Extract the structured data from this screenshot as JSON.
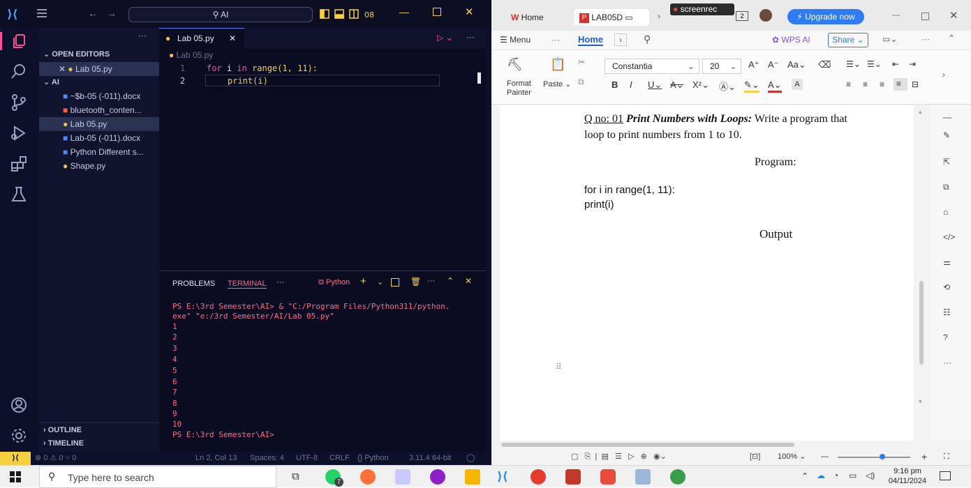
{
  "vscode": {
    "search": "AI",
    "explorer": {
      "open_editors_label": "OPEN EDITORS",
      "open_file": "Lab 05.py",
      "folder_label": "AI",
      "files": [
        "~$b-05 (-011).docx",
        "bluetooth_conten...",
        "Lab 05.py",
        "Lab-05 (-011).docx",
        "Python Different s...",
        "Shape.py"
      ],
      "outline_label": "OUTLINE",
      "timeline_label": "TIMELINE"
    },
    "tab_label": "Lab 05.py",
    "breadcrumb": "Lab 05.py",
    "code_lines": [
      {
        "num": "1",
        "kw1": "for",
        "var": "i",
        "kw2": "in",
        "fn": "range",
        "args": "(1, 11):"
      },
      {
        "num": "2",
        "fn": "print",
        "args": "(i)"
      }
    ],
    "panel": {
      "problems_label": "PROBLEMS",
      "terminal_label": "TERMINAL",
      "more_label": "···",
      "python_label": "Python",
      "lines": [
        "PS E:\\3rd Semester\\AI> & \"C:/Program Files/Python311/python.",
        "exe\" \"e:/3rd Semester/AI/Lab 05.py\"",
        "1",
        "2",
        "3",
        "4",
        "5",
        "6",
        "7",
        "8",
        "9",
        "10",
        "PS E:\\3rd Semester\\AI>"
      ]
    },
    "status": {
      "left": "⊗ 0 ⚠ 0   ⑂ 0",
      "position": "Ln 2, Col 13",
      "spaces": "Spaces: 4",
      "encoding": "UTF-8",
      "eol": "CRLF",
      "language": "{} Python",
      "interpreter": "3.11.4 64-bit"
    }
  },
  "wps": {
    "home_tab": "Home",
    "doc_tab": "LAB05D",
    "screenrec": "screenrec",
    "upgrade": "Upgrade now",
    "menu_label": "Menu",
    "menu_home": "Home",
    "wps_ai": "WPS AI",
    "share": "Share",
    "font_name": "Constantia",
    "font_size": "20",
    "format_painter_1": "Format",
    "format_painter_2": "Painter",
    "paste": "Paste",
    "doc": {
      "qno": "Q no: 01",
      "qtitle": "Print Numbers with Loops:",
      "qtext": "Write a program that",
      "qtext2": "loop to print numbers from 1 to 10.",
      "program_heading": "Program:",
      "code1": "for i in range(1, 11):",
      "code2": "print(i)",
      "output_heading": "Output"
    },
    "zoom": "100%"
  },
  "taskbar": {
    "search_placeholder": "Type here to search",
    "time": "9:16 pm",
    "date": "04/11/2024",
    "badge": "7"
  },
  "colors": {
    "vscode_bg": "#0c1028",
    "keyword": "#ff4f9a",
    "terminal_text": "#ff6b8a",
    "wps_accent": "#2f7bf5",
    "wps_home": "#1e5bd8"
  }
}
